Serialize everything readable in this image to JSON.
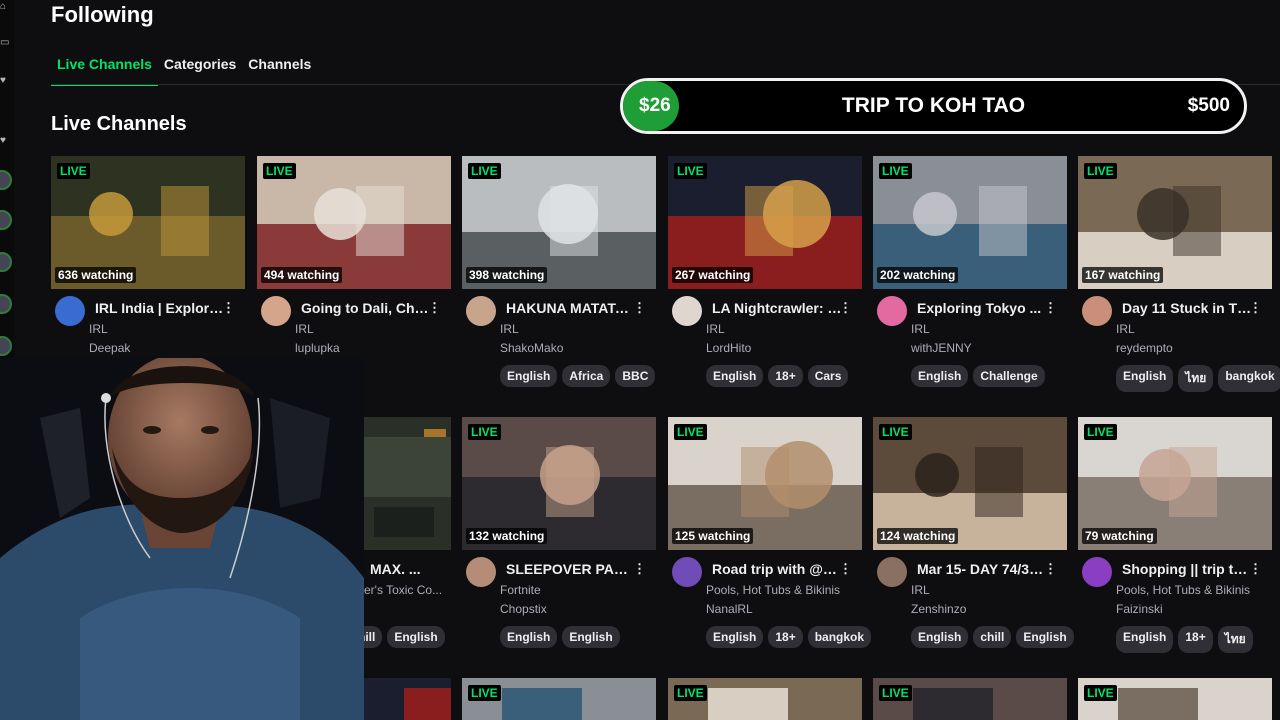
{
  "page_title": "Following",
  "tabs": [
    {
      "label": "Live Channels",
      "active": true
    },
    {
      "label": "Categories",
      "active": false
    },
    {
      "label": "Channels",
      "active": false
    }
  ],
  "section_title": "Live Channels",
  "goal": {
    "current": "$26",
    "title": "TRIP TO KOH TAO",
    "target": "$500",
    "progress": 0.052
  },
  "live_label": "LIVE",
  "row1": [
    {
      "viewers": "636 watching",
      "title": "IRL India | Explorin...",
      "category": "IRL",
      "streamer": "Deepak",
      "tags": []
    },
    {
      "viewers": "494 watching",
      "title": "Going to Dali, Chin...",
      "category": "IRL",
      "streamer": "luplupka",
      "tags": []
    },
    {
      "viewers": "398 watching",
      "title": "HAKUNA MATATA!...",
      "category": "IRL",
      "streamer": "ShakoMako",
      "tags": [
        "English",
        "Africa",
        "BBC"
      ]
    },
    {
      "viewers": "267 watching",
      "title": "LA Nightcrawler: C...",
      "category": "IRL",
      "streamer": "LordHito",
      "tags": [
        "English",
        "18+",
        "Cars"
      ]
    },
    {
      "viewers": "202 watching",
      "title": "Exploring Tokyo ...",
      "category": "IRL",
      "streamer": "withJENNY",
      "tags": [
        "English",
        "Challenge"
      ]
    },
    {
      "viewers": "167 watching",
      "title": "Day 11 Stuck in Th...",
      "category": "IRL",
      "streamer": "reydempto",
      "tags": [
        "English",
        "ไทย",
        "bangkok"
      ]
    }
  ],
  "row2_occluded": {
    "title_fragment": "MAX. ...",
    "category_fragment": "er's Toxic Co...",
    "tags": [
      "hill",
      "English"
    ]
  },
  "row2": [
    {
      "viewers": "132 watching",
      "title": "SLEEPOVER PART...",
      "category": "Fortnite",
      "streamer": "Chopstix",
      "tags": [
        "English",
        "English"
      ]
    },
    {
      "viewers": "125 watching",
      "title": "Road trip with @Fa...",
      "category": "Pools, Hot Tubs & Bikinis",
      "streamer": "NanalRL",
      "tags": [
        "English",
        "18+",
        "bangkok"
      ]
    },
    {
      "viewers": "124 watching",
      "title": "Mar 15- DAY 74/36...",
      "category": "IRL",
      "streamer": "Zenshinzo",
      "tags": [
        "English",
        "chill",
        "English"
      ]
    },
    {
      "viewers": "79 watching",
      "title": "Shopping || trip to...",
      "category": "Pools, Hot Tubs & Bikinis",
      "streamer": "Faizinski",
      "tags": [
        "English",
        "18+",
        "ไทย"
      ]
    }
  ],
  "kebab_glyph": "⋮",
  "colors": {
    "accent": "#00e36b",
    "background": "#0e0e10",
    "tag_bg": "#2f2f35",
    "goal_fill": "#1f9d36"
  }
}
